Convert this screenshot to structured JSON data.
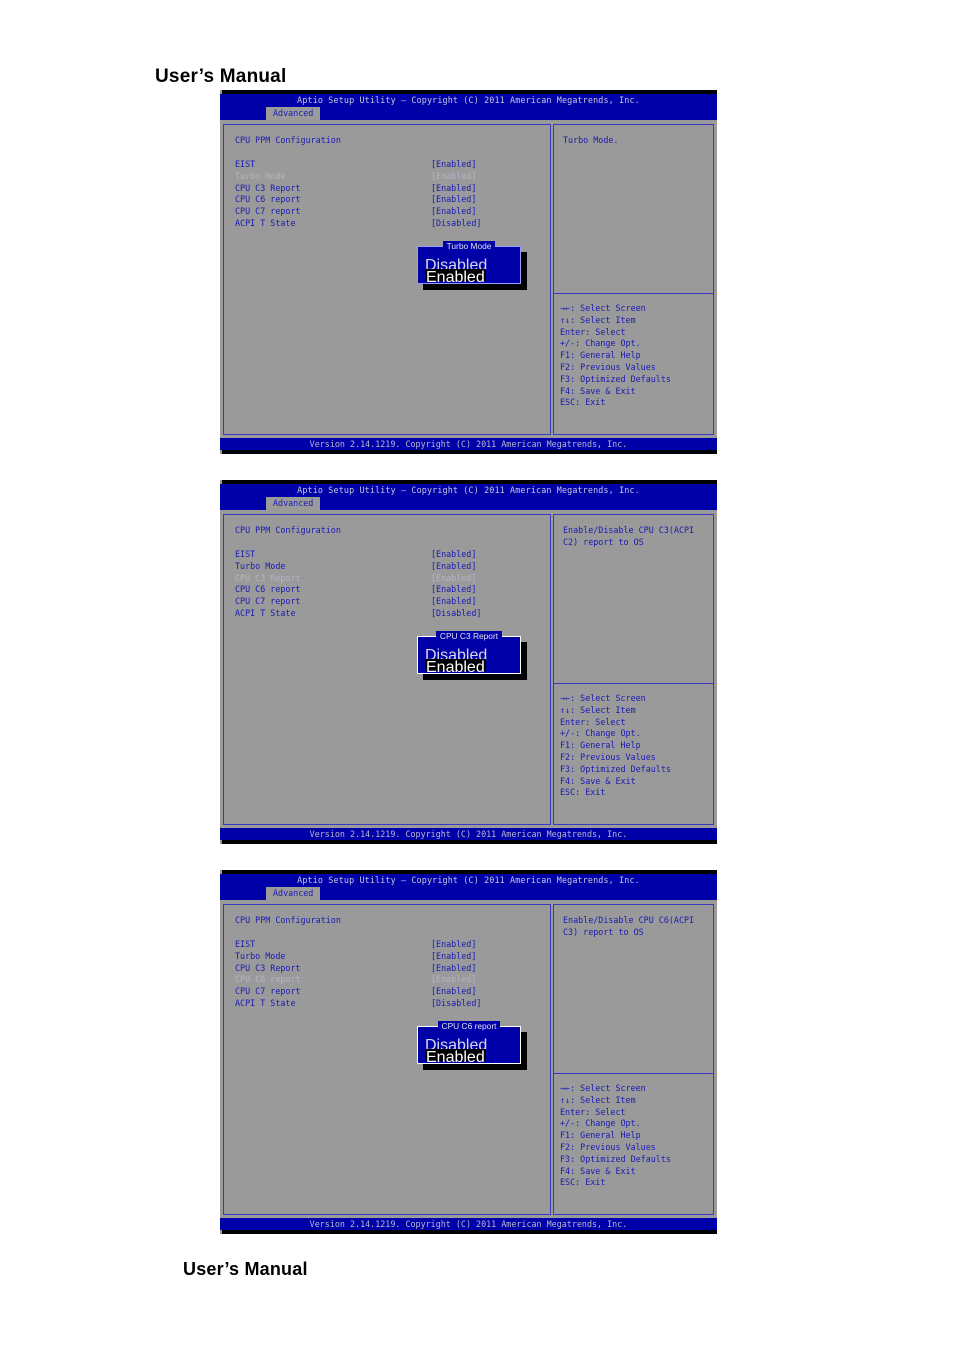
{
  "document": {
    "heading_top": "User’s Manual",
    "heading_bottom": "User’s Manual"
  },
  "colors": {
    "bios_blue": "#0000a8",
    "bios_gray": "#9a9a9a",
    "text_blue": "#1a1ab4",
    "text_dim": "#b5b5c4",
    "highlight_bg": "#000000"
  },
  "common": {
    "title": "Aptio Setup Utility – Copyright (C) 2011 American Megatrends, Inc.",
    "tab": "Advanced",
    "section_title": "CPU PPM Configuration",
    "footer": "Version 2.14.1219. Copyright (C) 2011 American Megatrends, Inc.",
    "options": [
      {
        "label": "EIST",
        "value": "[Enabled]"
      },
      {
        "label": "Turbo Mode",
        "value": "[Enabled]"
      },
      {
        "label": "CPU C3 Report",
        "value": "[Enabled]"
      },
      {
        "label": "CPU C6 report",
        "value": "[Enabled]"
      },
      {
        "label": "CPU C7 report",
        "value": "[Enabled]"
      },
      {
        "label": "ACPI T State",
        "value": "[Disabled]"
      }
    ],
    "keys": [
      "→←: Select Screen",
      "↑↓: Select Item",
      "Enter: Select",
      "+/-: Change Opt.",
      "F1: General Help",
      "F2: Previous Values",
      "F3: Optimized Defaults",
      "F4: Save & Exit",
      "ESC: Exit"
    ]
  },
  "screens": [
    {
      "id": "screen-turbo-mode",
      "selected_index": 1,
      "help": "Turbo Mode.",
      "popup": {
        "title": "Turbo Mode",
        "options": [
          "Disabled",
          "Enabled"
        ],
        "selected": "Enabled"
      }
    },
    {
      "id": "screen-cpu-c3-report",
      "selected_index": 2,
      "help": "Enable/Disable CPU C3(ACPI C2) report to OS",
      "popup": {
        "title": "CPU C3 Report",
        "options": [
          "Disabled",
          "Enabled"
        ],
        "selected": "Enabled"
      }
    },
    {
      "id": "screen-cpu-c6-report",
      "selected_index": 3,
      "help": "Enable/Disable CPU C6(ACPI C3) report to OS",
      "popup": {
        "title": "CPU C6 report",
        "options": [
          "Disabled",
          "Enabled"
        ],
        "selected": "Enabled"
      }
    }
  ]
}
